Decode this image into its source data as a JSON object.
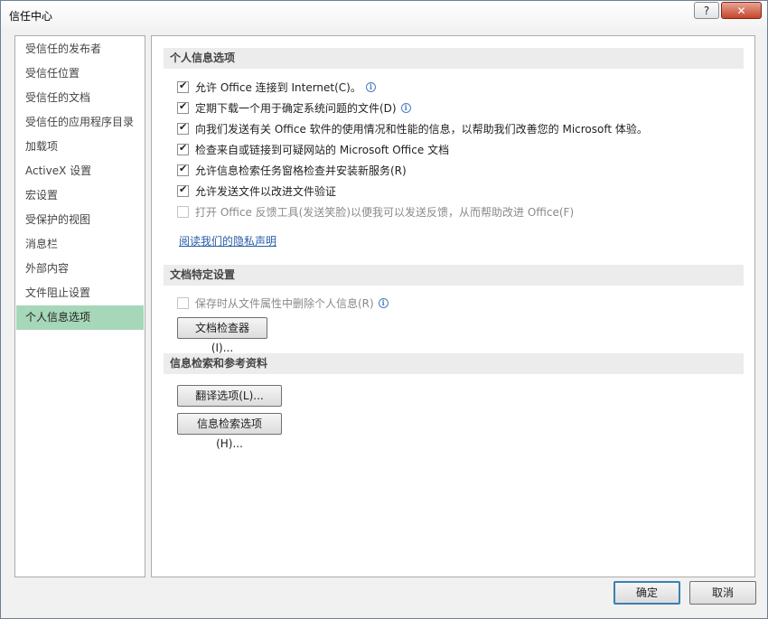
{
  "window": {
    "title": "信任中心",
    "help_label": "?",
    "close_label": "✕"
  },
  "sidebar": {
    "items": [
      {
        "label": "受信任的发布者",
        "active": false
      },
      {
        "label": "受信任位置",
        "active": false
      },
      {
        "label": "受信任的文档",
        "active": false
      },
      {
        "label": "受信任的应用程序目录",
        "active": false
      },
      {
        "label": "加载项",
        "active": false
      },
      {
        "label": "ActiveX 设置",
        "active": false
      },
      {
        "label": "宏设置",
        "active": false
      },
      {
        "label": "受保护的视图",
        "active": false
      },
      {
        "label": "消息栏",
        "active": false
      },
      {
        "label": "外部内容",
        "active": false
      },
      {
        "label": "文件阻止设置",
        "active": false
      },
      {
        "label": "个人信息选项",
        "active": true
      }
    ]
  },
  "privacy": {
    "header": "个人信息选项",
    "options": [
      {
        "label": "允许 Office 连接到 Internet(C)。",
        "checked": true,
        "disabled": false,
        "info": true
      },
      {
        "label": "定期下载一个用于确定系统问题的文件(D)",
        "checked": true,
        "disabled": false,
        "info": true
      },
      {
        "label": "向我们发送有关 Office 软件的使用情况和性能的信息，以帮助我们改善您的 Microsoft 体验。",
        "checked": true,
        "disabled": false,
        "info": false
      },
      {
        "label": "检查来自或链接到可疑网站的 Microsoft Office 文档",
        "checked": true,
        "disabled": false,
        "info": false
      },
      {
        "label": "允许信息检索任务窗格检查并安装新服务(R)",
        "checked": true,
        "disabled": false,
        "info": false
      },
      {
        "label": "允许发送文件以改进文件验证",
        "checked": true,
        "disabled": false,
        "info": false
      },
      {
        "label": "打开 Office 反馈工具(发送笑脸)以便我可以发送反馈，从而帮助改进 Office(F)",
        "checked": false,
        "disabled": true,
        "info": false
      }
    ],
    "privacy_link": "阅读我们的隐私声明"
  },
  "document": {
    "header": "文档特定设置",
    "option": {
      "label": "保存时从文件属性中删除个人信息(R)",
      "checked": false,
      "disabled": true,
      "info": true
    },
    "inspector_button": "文档检查器(I)..."
  },
  "research": {
    "header": "信息检索和参考资料",
    "translation_button": "翻译选项(L)...",
    "research_button": "信息检索选项(H)..."
  },
  "footer": {
    "ok": "确定",
    "cancel": "取消"
  },
  "colors": {
    "active_nav": "#a6d7b8",
    "link": "#2a5ca5",
    "section_header_bg": "#ececec"
  }
}
